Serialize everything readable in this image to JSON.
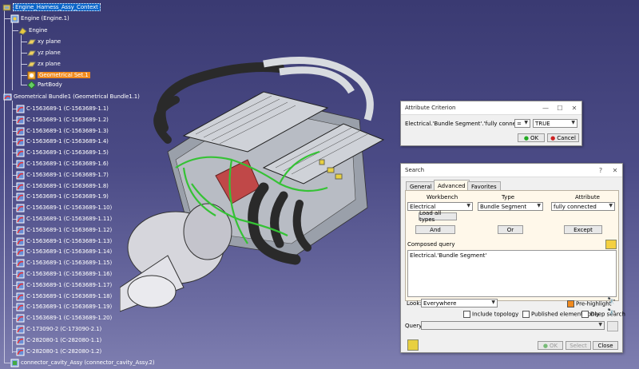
{
  "tree": {
    "root": "Engine_Harness_Assy_Context",
    "engine_instance": "Engine (Engine.1)",
    "engine_part": "Engine",
    "planes": [
      "xy plane",
      "yz plane",
      "zx plane"
    ],
    "geoset": "Geometrical Set.1",
    "partbody": "PartBody",
    "bundle": "Geometrical Bundle1 (Geometrical Bundle1.1)",
    "segments": [
      "C-1563689-1 (C-1563689-1.1)",
      "C-1563689-1 (C-1563689-1.2)",
      "C-1563689-1 (C-1563689-1.3)",
      "C-1563689-1 (C-1563689-1.4)",
      "C-1563689-1 (C-1563689-1.5)",
      "C-1563689-1 (C-1563689-1.6)",
      "C-1563689-1 (C-1563689-1.7)",
      "C-1563689-1 (C-1563689-1.8)",
      "C-1563689-1 (C-1563689-1.9)",
      "C-1563689-1 (C-1563689-1.10)",
      "C-1563689-1 (C-1563689-1.11)",
      "C-1563689-1 (C-1563689-1.12)",
      "C-1563689-1 (C-1563689-1.13)",
      "C-1563689-1 (C-1563689-1.14)",
      "C-1563689-1 (C-1563689-1.15)",
      "C-1563689-1 (C-1563689-1.16)",
      "C-1563689-1 (C-1563689-1.17)",
      "C-1563689-1 (C-1563689-1.18)",
      "C-1563689-1 (C-1563689-1.19)",
      "C-1563689-1 (C-1563689-1.20)",
      "C-173090-2 (C-173090-2.1)",
      "C-282080-1 (C-282080-1.1)",
      "C-282080-1 (C-282080-1.2)"
    ],
    "connector": "connector_cavity_Assy (connector_cavity_Assy.2)"
  },
  "attr_dialog": {
    "title": "Attribute Criterion",
    "criterion": "Electrical.'Bundle Segment'.'fully connected'",
    "operator": "=",
    "value": "TRUE",
    "ok": "OK",
    "cancel": "Cancel"
  },
  "search_dialog": {
    "title": "Search",
    "tabs": [
      "General",
      "Advanced",
      "Favorites"
    ],
    "workbench_label": "Workbench",
    "type_label": "Type",
    "attribute_label": "Attribute",
    "workbench_value": "Electrical",
    "type_value": "Bundle Segment",
    "attribute_value": "fully connected",
    "load_all": "Load all types",
    "and": "And",
    "or": "Or",
    "except": "Except",
    "composed_label": "Composed query",
    "composed_text": "Electrical.'Bundle Segment'",
    "look_label": "Look:",
    "look_value": "Everywhere",
    "prehighlight": "Pre-highlight",
    "include_topology": "Include topology",
    "published_only": "Published elements only",
    "deep_search": "Deep search",
    "query_label": "Query:",
    "ok": "OK",
    "select": "Select",
    "close": "Close"
  },
  "colors": {
    "background_top": "#3a3a72",
    "background_bottom": "#7e7eb0",
    "harness": "#35c235",
    "selection": "#0a64c8",
    "geoset": "#f08a1e"
  }
}
